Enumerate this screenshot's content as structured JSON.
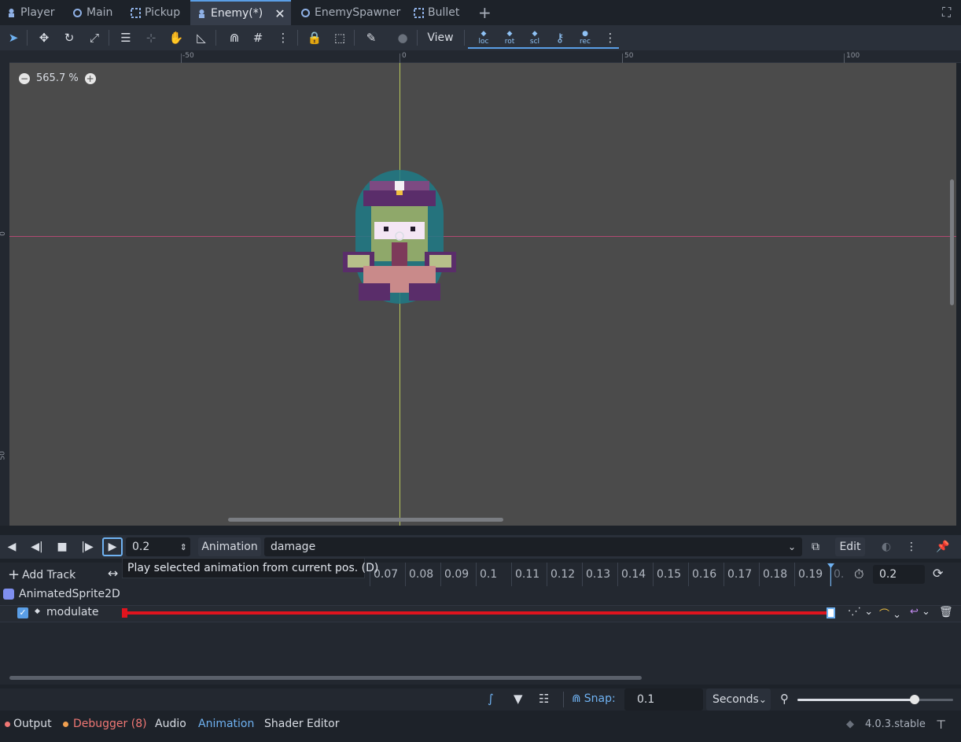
{
  "tabs": [
    {
      "label": "Player",
      "icon": "node-icon"
    },
    {
      "label": "Main",
      "icon": "circle-icon"
    },
    {
      "label": "Pickup",
      "icon": "area-icon"
    },
    {
      "label": "Enemy(*)",
      "icon": "node-icon",
      "active": true
    },
    {
      "label": "EnemySpawner",
      "icon": "circle-icon"
    },
    {
      "label": "Bullet",
      "icon": "area-icon"
    }
  ],
  "toolbar": {
    "view_label": "View",
    "key_labels": [
      "loc",
      "rot",
      "scl",
      "",
      "rec"
    ]
  },
  "viewport": {
    "zoom": "565.7 %",
    "ruler_h": [
      "-50",
      "0",
      "50",
      "100"
    ],
    "ruler_v": [
      "0",
      "50"
    ]
  },
  "animation": {
    "time_value": "0.2",
    "menu_label": "Animation",
    "selected_animation": "damage",
    "edit_label": "Edit",
    "tooltip": "Play selected animation from current pos. (D)"
  },
  "tracks": {
    "add_track_label": "Add Track",
    "timeline_ticks": [
      "0.07",
      "0.08",
      "0.09",
      "0.1",
      "0.11",
      "0.12",
      "0.13",
      "0.14",
      "0.15",
      "0.16",
      "0.17",
      "0.18",
      "0.19",
      "0."
    ],
    "length_value": "0.2",
    "node_name": "AnimatedSprite2D",
    "property_name": "modulate"
  },
  "bottom": {
    "snap_label": "Snap:",
    "snap_value": "0.1",
    "unit_label": "Seconds",
    "zoom_level": 0.75
  },
  "status": {
    "output_label": "Output",
    "debugger_label": "Debugger (8)",
    "audio_label": "Audio",
    "animation_label": "Animation",
    "shader_label": "Shader Editor",
    "version": "4.0.3.stable"
  },
  "colors": {
    "accent": "#5a9ee6",
    "track_red": "#e0141e",
    "debugger": "#f07774",
    "animation_tab": "#6fb2f2"
  }
}
